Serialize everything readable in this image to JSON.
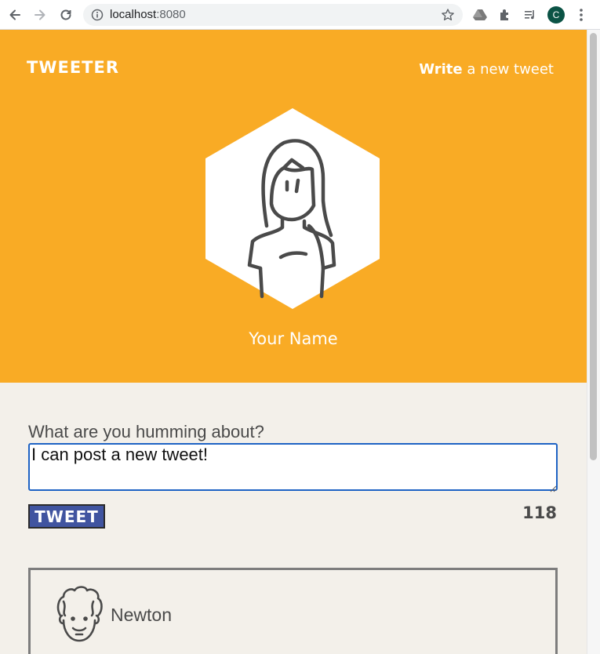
{
  "browser": {
    "url_host": "localhost",
    "url_port": ":8080",
    "profile_initial": "C"
  },
  "header": {
    "brand": "TWEETER",
    "compose_link_strong": "Write",
    "compose_link_rest": " a new tweet",
    "user_name": "Your Name"
  },
  "compose": {
    "label": "What are you humming about?",
    "textarea_value": "I can post a new tweet!",
    "button_label": "TWEET",
    "char_count": "118"
  },
  "tweets": [
    {
      "author": "Newton"
    }
  ],
  "colors": {
    "header_bg": "#f9ab25",
    "page_bg": "#f3f0ea",
    "button_bg": "#4054a0",
    "text_dark": "#4a4a4a"
  },
  "icons": {
    "back": "arrow-left",
    "forward": "arrow-right",
    "reload": "reload",
    "info": "info-circle",
    "bookmark": "star-outline",
    "drive": "drive-triangle",
    "extensions": "puzzle",
    "media": "music-queue",
    "menu": "vertical-dots"
  }
}
